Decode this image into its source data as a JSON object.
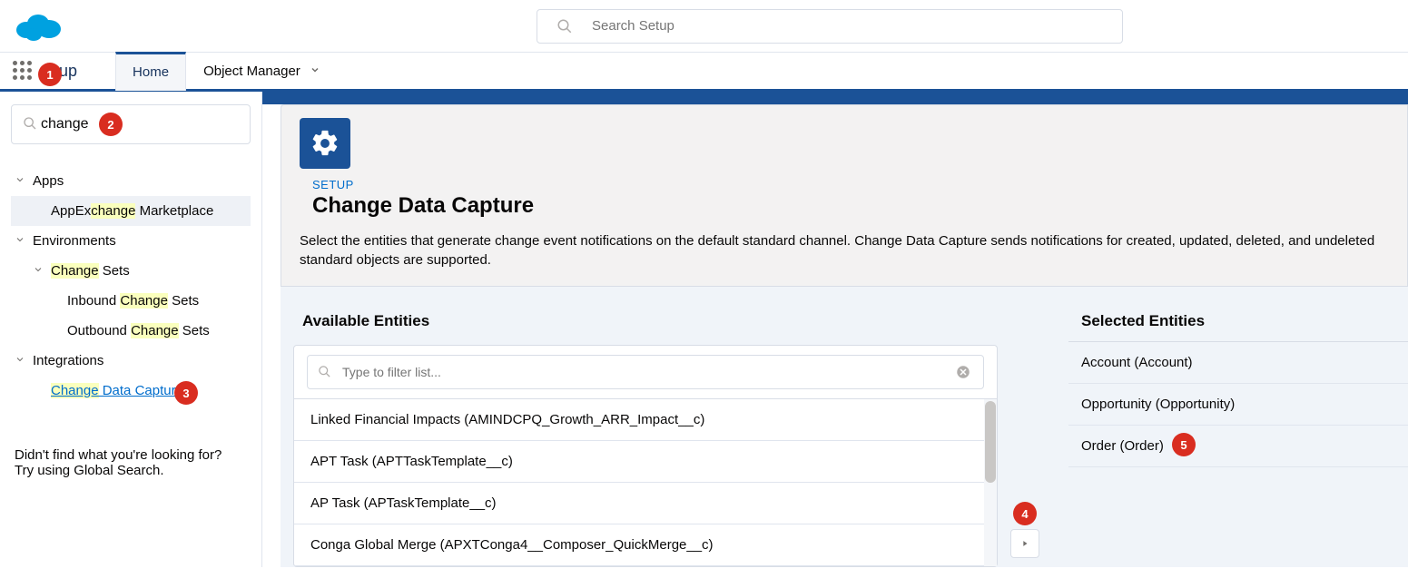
{
  "topbar": {
    "search_placeholder": "Search Setup"
  },
  "nav": {
    "app_title": "etup",
    "tab_home": "Home",
    "tab_obj": "Object Manager"
  },
  "sidebar": {
    "search_value": "change",
    "apps_label": "Apps",
    "appexchange_pre": "AppEx",
    "appexchange_hl": "change",
    "appexchange_post": " Marketplace",
    "env_label": "Environments",
    "changesets_hl": "Change",
    "changesets_post": " Sets",
    "inbound_pre": "Inbound ",
    "inbound_hl": "Change",
    "inbound_post": " Sets",
    "outbound_pre": "Outbound ",
    "outbound_hl": "Change",
    "outbound_post": " Sets",
    "integrations_label": "Integrations",
    "cdc_hl": "Change",
    "cdc_post": " Data Capture",
    "help_line1": "Didn't find what you're looking for?",
    "help_line2a": "Try using ",
    "help_line2b": "Global Search",
    "help_line2c": "."
  },
  "header": {
    "crumb": "SETUP",
    "title": "Change Data Capture",
    "desc": "Select the entities that generate change event notifications on the default standard channel. Change Data Capture sends notifications for created, updated, deleted, and undeleted standard objects are supported."
  },
  "avail": {
    "title": "Available Entities",
    "filter_placeholder": "Type to filter list...",
    "items": [
      "Linked Financial Impacts (AMINDCPQ_Growth_ARR_Impact__c)",
      "APT Task (APTTaskTemplate__c)",
      "AP Task (APTaskTemplate__c)",
      "Conga Global Merge (APXTConga4__Composer_QuickMerge__c)"
    ]
  },
  "selected": {
    "title": "Selected Entities",
    "items": [
      "Account (Account)",
      "Opportunity (Opportunity)",
      "Order (Order)"
    ]
  },
  "markers": {
    "m1": "1",
    "m2": "2",
    "m3": "3",
    "m4": "4",
    "m5": "5"
  }
}
